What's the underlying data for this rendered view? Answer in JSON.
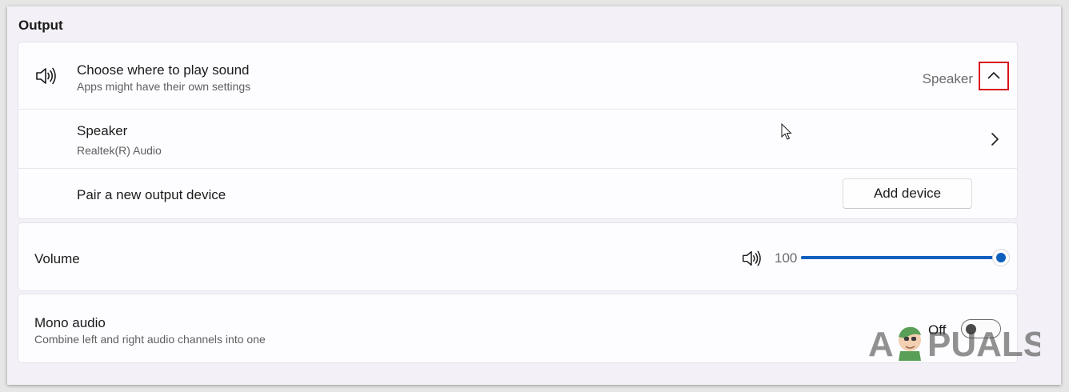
{
  "section": {
    "title": "Output"
  },
  "choose": {
    "icon": "speaker-icon",
    "title": "Choose where to play sound",
    "subtitle": "Apps might have their own settings",
    "value": "Speaker",
    "collapse_icon": "chevron-up-icon"
  },
  "speaker": {
    "title": "Speaker",
    "subtitle": "Realtek(R) Audio",
    "nav_icon": "chevron-right-icon"
  },
  "pair": {
    "label": "Pair a new output device",
    "button_label": "Add device"
  },
  "volume": {
    "label": "Volume",
    "icon": "speaker-volume-icon",
    "value_text": "100",
    "level_percent": 100
  },
  "mono": {
    "title": "Mono audio",
    "subtitle": "Combine left and right audio channels into one",
    "state_label": "Off",
    "enabled": false
  },
  "watermark": {
    "text": "A PUALS"
  },
  "colors": {
    "accent": "#0f5fbf",
    "highlight_box": "#d9141b",
    "background": "#f3f1f7",
    "card": "#fdfcff"
  }
}
